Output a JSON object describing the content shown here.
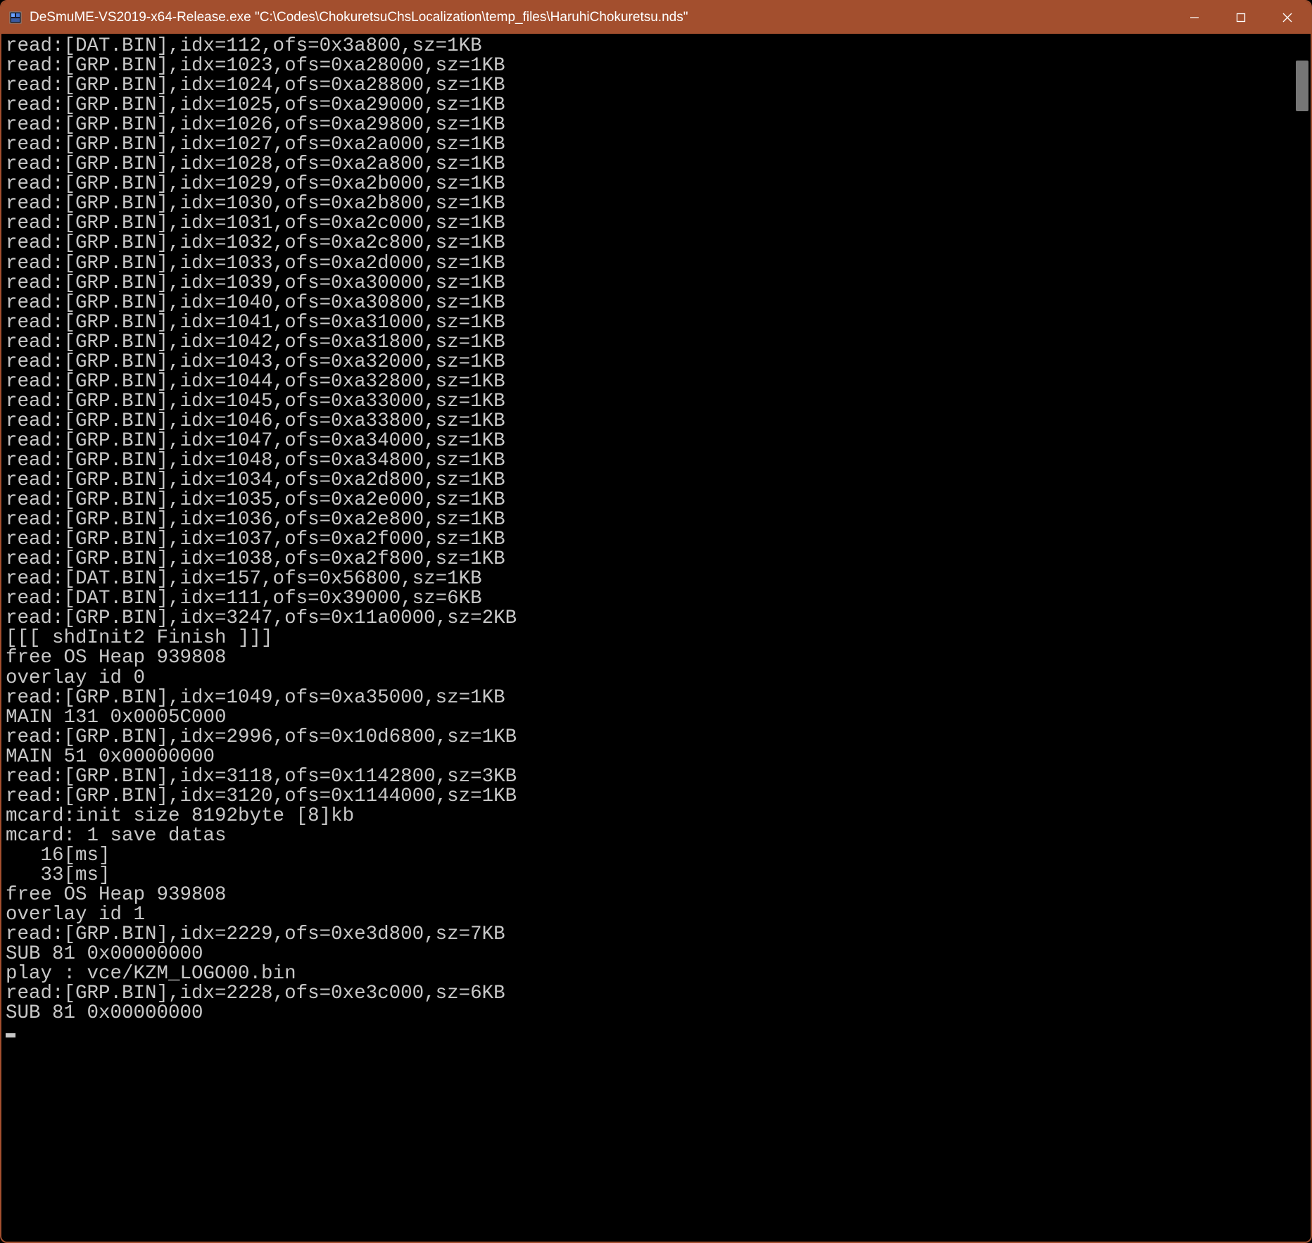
{
  "window": {
    "title": "DeSmuME-VS2019-x64-Release.exe \"C:\\Codes\\ChokuretsuChsLocalization\\temp_files\\HaruhiChokuretsu.nds\""
  },
  "console": {
    "lines": [
      "read:[DAT.BIN],idx=112,ofs=0x3a800,sz=1KB",
      "read:[GRP.BIN],idx=1023,ofs=0xa28000,sz=1KB",
      "read:[GRP.BIN],idx=1024,ofs=0xa28800,sz=1KB",
      "read:[GRP.BIN],idx=1025,ofs=0xa29000,sz=1KB",
      "read:[GRP.BIN],idx=1026,ofs=0xa29800,sz=1KB",
      "read:[GRP.BIN],idx=1027,ofs=0xa2a000,sz=1KB",
      "read:[GRP.BIN],idx=1028,ofs=0xa2a800,sz=1KB",
      "read:[GRP.BIN],idx=1029,ofs=0xa2b000,sz=1KB",
      "read:[GRP.BIN],idx=1030,ofs=0xa2b800,sz=1KB",
      "read:[GRP.BIN],idx=1031,ofs=0xa2c000,sz=1KB",
      "read:[GRP.BIN],idx=1032,ofs=0xa2c800,sz=1KB",
      "read:[GRP.BIN],idx=1033,ofs=0xa2d000,sz=1KB",
      "read:[GRP.BIN],idx=1039,ofs=0xa30000,sz=1KB",
      "read:[GRP.BIN],idx=1040,ofs=0xa30800,sz=1KB",
      "read:[GRP.BIN],idx=1041,ofs=0xa31000,sz=1KB",
      "read:[GRP.BIN],idx=1042,ofs=0xa31800,sz=1KB",
      "read:[GRP.BIN],idx=1043,ofs=0xa32000,sz=1KB",
      "read:[GRP.BIN],idx=1044,ofs=0xa32800,sz=1KB",
      "read:[GRP.BIN],idx=1045,ofs=0xa33000,sz=1KB",
      "read:[GRP.BIN],idx=1046,ofs=0xa33800,sz=1KB",
      "read:[GRP.BIN],idx=1047,ofs=0xa34000,sz=1KB",
      "read:[GRP.BIN],idx=1048,ofs=0xa34800,sz=1KB",
      "read:[GRP.BIN],idx=1034,ofs=0xa2d800,sz=1KB",
      "read:[GRP.BIN],idx=1035,ofs=0xa2e000,sz=1KB",
      "read:[GRP.BIN],idx=1036,ofs=0xa2e800,sz=1KB",
      "read:[GRP.BIN],idx=1037,ofs=0xa2f000,sz=1KB",
      "read:[GRP.BIN],idx=1038,ofs=0xa2f800,sz=1KB",
      "read:[DAT.BIN],idx=157,ofs=0x56800,sz=1KB",
      "read:[DAT.BIN],idx=111,ofs=0x39000,sz=6KB",
      "read:[GRP.BIN],idx=3247,ofs=0x11a0000,sz=2KB",
      "[[[ shdInit2 Finish ]]]",
      "free OS Heap 939808",
      "overlay id 0",
      "read:[GRP.BIN],idx=1049,ofs=0xa35000,sz=1KB",
      "MAIN 131 0x0005C000",
      "read:[GRP.BIN],idx=2996,ofs=0x10d6800,sz=1KB",
      "MAIN 51 0x00000000",
      "read:[GRP.BIN],idx=3118,ofs=0x1142800,sz=3KB",
      "read:[GRP.BIN],idx=3120,ofs=0x1144000,sz=1KB",
      "mcard:init size 8192byte [8]kb",
      "mcard: 1 save datas",
      "   16[ms]",
      "   33[ms]",
      "free OS Heap 939808",
      "overlay id 1",
      "read:[GRP.BIN],idx=2229,ofs=0xe3d800,sz=7KB",
      "SUB 81 0x00000000",
      "play : vce/KZM_LOGO00.bin",
      "read:[GRP.BIN],idx=2228,ofs=0xe3c000,sz=6KB",
      "SUB 81 0x00000000"
    ]
  }
}
